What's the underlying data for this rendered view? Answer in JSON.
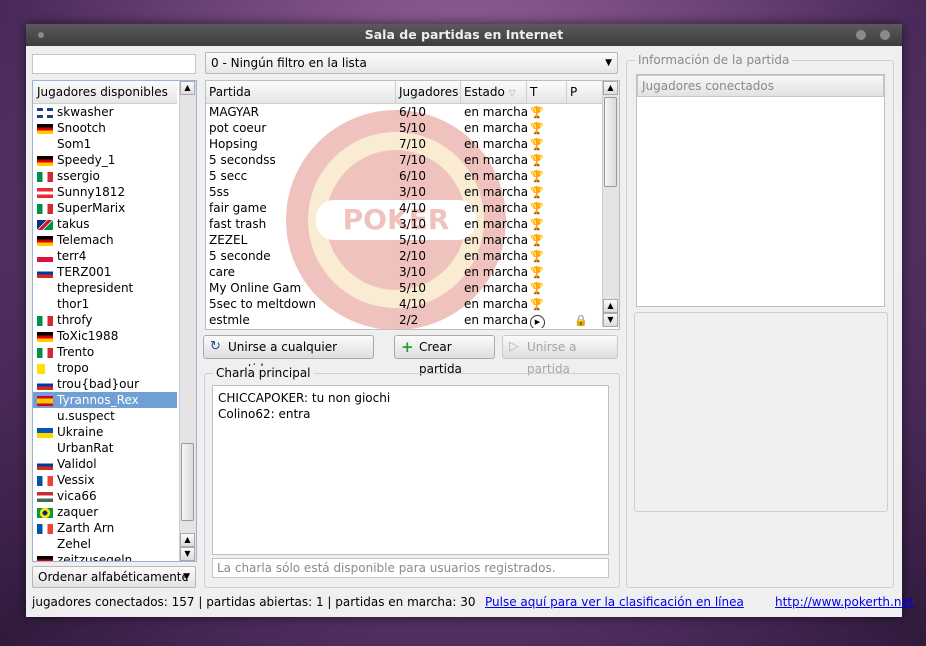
{
  "window": {
    "title": "Sala de partidas en Internet"
  },
  "players": {
    "header": "Jugadores disponibles",
    "items": [
      {
        "name": "skwasher",
        "flag": "uk"
      },
      {
        "name": "Snootch",
        "flag": "de"
      },
      {
        "name": "Som1",
        "flag": ""
      },
      {
        "name": "Speedy_1",
        "flag": "de"
      },
      {
        "name": "ssergio",
        "flag": "it"
      },
      {
        "name": "Sunny1812",
        "flag": "at"
      },
      {
        "name": "SuperMarix",
        "flag": "it"
      },
      {
        "name": "takus",
        "flag": "na"
      },
      {
        "name": "Telemach",
        "flag": "de"
      },
      {
        "name": "terr4",
        "flag": "pl"
      },
      {
        "name": "TERZ001",
        "flag": "ru"
      },
      {
        "name": "thepresident",
        "flag": ""
      },
      {
        "name": "thor1",
        "flag": ""
      },
      {
        "name": "throfy",
        "flag": "it"
      },
      {
        "name": "ToXic1988",
        "flag": "de"
      },
      {
        "name": "Trento",
        "flag": "it"
      },
      {
        "name": "tropo",
        "flag": "va"
      },
      {
        "name": "trou{bad}our",
        "flag": "ru"
      },
      {
        "name": "Tyrannos_Rex",
        "flag": "es",
        "selected": true
      },
      {
        "name": "u.suspect",
        "flag": ""
      },
      {
        "name": "Ukraine",
        "flag": "ua"
      },
      {
        "name": "UrbanRat",
        "flag": ""
      },
      {
        "name": "Validol",
        "flag": "ru"
      },
      {
        "name": "Vessix",
        "flag": "fr"
      },
      {
        "name": "vica66",
        "flag": "hu"
      },
      {
        "name": "zaquer",
        "flag": "br"
      },
      {
        "name": "Zarth Arn",
        "flag": "fr"
      },
      {
        "name": "Zehel",
        "flag": ""
      },
      {
        "name": "zeitzusegeln",
        "flag": "de"
      }
    ],
    "sort": "Ordenar alfabéticamente"
  },
  "filter": {
    "value": "0 - Ningún filtro en la lista"
  },
  "games": {
    "columns": [
      "Partida",
      "Jugadores",
      "Estado",
      "T",
      "P"
    ],
    "rows": [
      {
        "name": "MAGYAR",
        "players": "6/10",
        "state": "en marcha",
        "icon": "trophy"
      },
      {
        "name": "pot coeur",
        "players": "5/10",
        "state": "en marcha",
        "icon": "trophy"
      },
      {
        "name": "Hopsing",
        "players": "7/10",
        "state": "en marcha",
        "icon": "trophy"
      },
      {
        "name": "5 secondss",
        "players": "7/10",
        "state": "en marcha",
        "icon": "trophy"
      },
      {
        "name": "5 secc",
        "players": "6/10",
        "state": "en marcha",
        "icon": "trophy"
      },
      {
        "name": "5ss",
        "players": "3/10",
        "state": "en marcha",
        "icon": "trophy"
      },
      {
        "name": "fair game",
        "players": "4/10",
        "state": "en marcha",
        "icon": "trophy"
      },
      {
        "name": "fast trash",
        "players": "3/10",
        "state": "en marcha",
        "icon": "trophy"
      },
      {
        "name": "ZEZEL",
        "players": "5/10",
        "state": "en marcha",
        "icon": "trophy"
      },
      {
        "name": "5 seconde",
        "players": "2/10",
        "state": "en marcha",
        "icon": "trophy"
      },
      {
        "name": "care",
        "players": "3/10",
        "state": "en marcha",
        "icon": "trophy"
      },
      {
        "name": "My Online Gam",
        "players": "5/10",
        "state": "en marcha",
        "icon": "trophy"
      },
      {
        "name": "5sec to meltdown",
        "players": "4/10",
        "state": "en marcha",
        "icon": "trophy"
      },
      {
        "name": "estmle",
        "players": "2/2",
        "state": "en marcha",
        "icon": "play",
        "lock": true
      }
    ]
  },
  "buttons": {
    "join_any": "Unirse a cualquier partida",
    "create": "Crear partida",
    "join": "Unirse a partida"
  },
  "chat": {
    "title": "Charla principal",
    "messages": [
      "CHICCAPOKER: tu non giochi",
      "Colino62: entra"
    ],
    "input_placeholder": "La charla sólo está disponible para usuarios registrados."
  },
  "info": {
    "title": "Información de la partida",
    "connected_header": "Jugadores conectados"
  },
  "status": {
    "text": "jugadores conectados: 157  | partidas abiertas: 1  | partidas en marcha: 30",
    "ranking_link": "Pulse aquí para ver la clasificación en línea",
    "site_link": "http://www.pokerth.net"
  }
}
